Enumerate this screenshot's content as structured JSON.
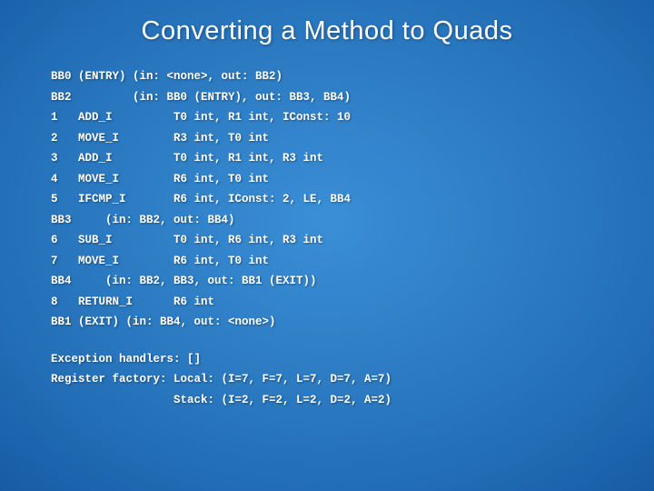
{
  "title": "Converting a Method to Quads",
  "lines": [
    "BB0 (ENTRY) (in: <none>, out: BB2)",
    "BB2         (in: BB0 (ENTRY), out: BB3, BB4)",
    "1   ADD_I         T0 int, R1 int, IConst: 10",
    "2   MOVE_I        R3 int, T0 int",
    "3   ADD_I         T0 int, R1 int, R3 int",
    "4   MOVE_I        R6 int, T0 int",
    "5   IFCMP_I       R6 int, IConst: 2, LE, BB4",
    "BB3     (in: BB2, out: BB4)",
    "6   SUB_I         T0 int, R6 int, R3 int",
    "7   MOVE_I        R6 int, T0 int",
    "BB4     (in: BB2, BB3, out: BB1 (EXIT))",
    "8   RETURN_I      R6 int",
    "BB1 (EXIT) (in: BB4, out: <none>)"
  ],
  "footer": {
    "exception": "Exception handlers: []",
    "registerLocal": "Register factory: Local: (I=7, F=7, L=7, D=7, A=7)",
    "registerStack": "                  Stack: (I=2, F=2, L=2, D=2, A=2)"
  }
}
